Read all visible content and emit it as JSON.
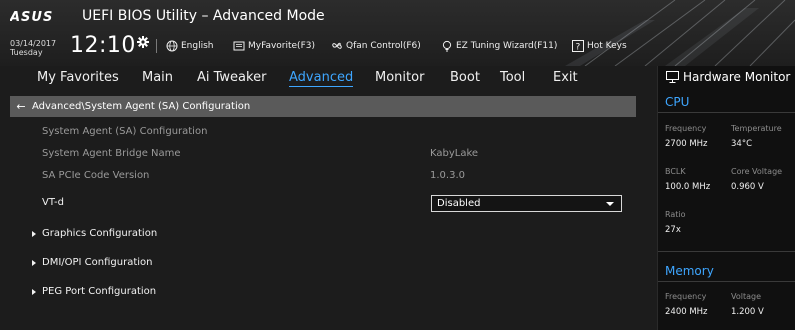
{
  "header": {
    "brand": "ASUS",
    "title": "UEFI BIOS Utility – Advanced Mode",
    "date": "03/14/2017",
    "day": "Tuesday",
    "time": "12:10",
    "tools": [
      {
        "icon": "globe-icon",
        "label": "English"
      },
      {
        "icon": "favorites-icon",
        "label": "MyFavorite(F3)"
      },
      {
        "icon": "fan-icon",
        "label": "Qfan Control(F6)"
      },
      {
        "icon": "bulb-icon",
        "label": "EZ Tuning Wizard(F11)"
      },
      {
        "icon": "help-icon",
        "label": "Hot Keys"
      }
    ]
  },
  "menu": {
    "items": [
      "My Favorites",
      "Main",
      "Ai Tweaker",
      "Advanced",
      "Monitor",
      "Boot",
      "Tool",
      "Exit"
    ],
    "active": "Advanced"
  },
  "page": {
    "breadcrumb": "Advanced\\System Agent (SA) Configuration",
    "rows": [
      {
        "label": "System Agent (SA) Configuration",
        "value": ""
      },
      {
        "label": "System Agent Bridge Name",
        "value": "KabyLake"
      },
      {
        "label": "SA PCIe Code Version",
        "value": "1.0.3.0"
      }
    ],
    "vtd": {
      "label": "VT-d",
      "value": "Disabled"
    },
    "submenus": [
      "Graphics Configuration",
      "DMI/OPI Configuration",
      "PEG Port Configuration"
    ]
  },
  "hardware_monitor": {
    "title": "Hardware Monitor",
    "cpu": {
      "section": "CPU",
      "frequency_label": "Frequency",
      "frequency": "2700 MHz",
      "temperature_label": "Temperature",
      "temperature": "34°C",
      "bclk_label": "BCLK",
      "bclk": "100.0 MHz",
      "core_voltage_label": "Core Voltage",
      "core_voltage": "0.960 V",
      "ratio_label": "Ratio",
      "ratio": "27x"
    },
    "memory": {
      "section": "Memory",
      "frequency_label": "Frequency",
      "frequency": "2400 MHz",
      "voltage_label": "Voltage",
      "voltage": "1.200 V"
    }
  },
  "colors": {
    "accent": "#3ea6ff",
    "background": "#1c1c1c",
    "breadcrumb_bar": "#5a5a5a",
    "monitor_panel": "#101010"
  }
}
